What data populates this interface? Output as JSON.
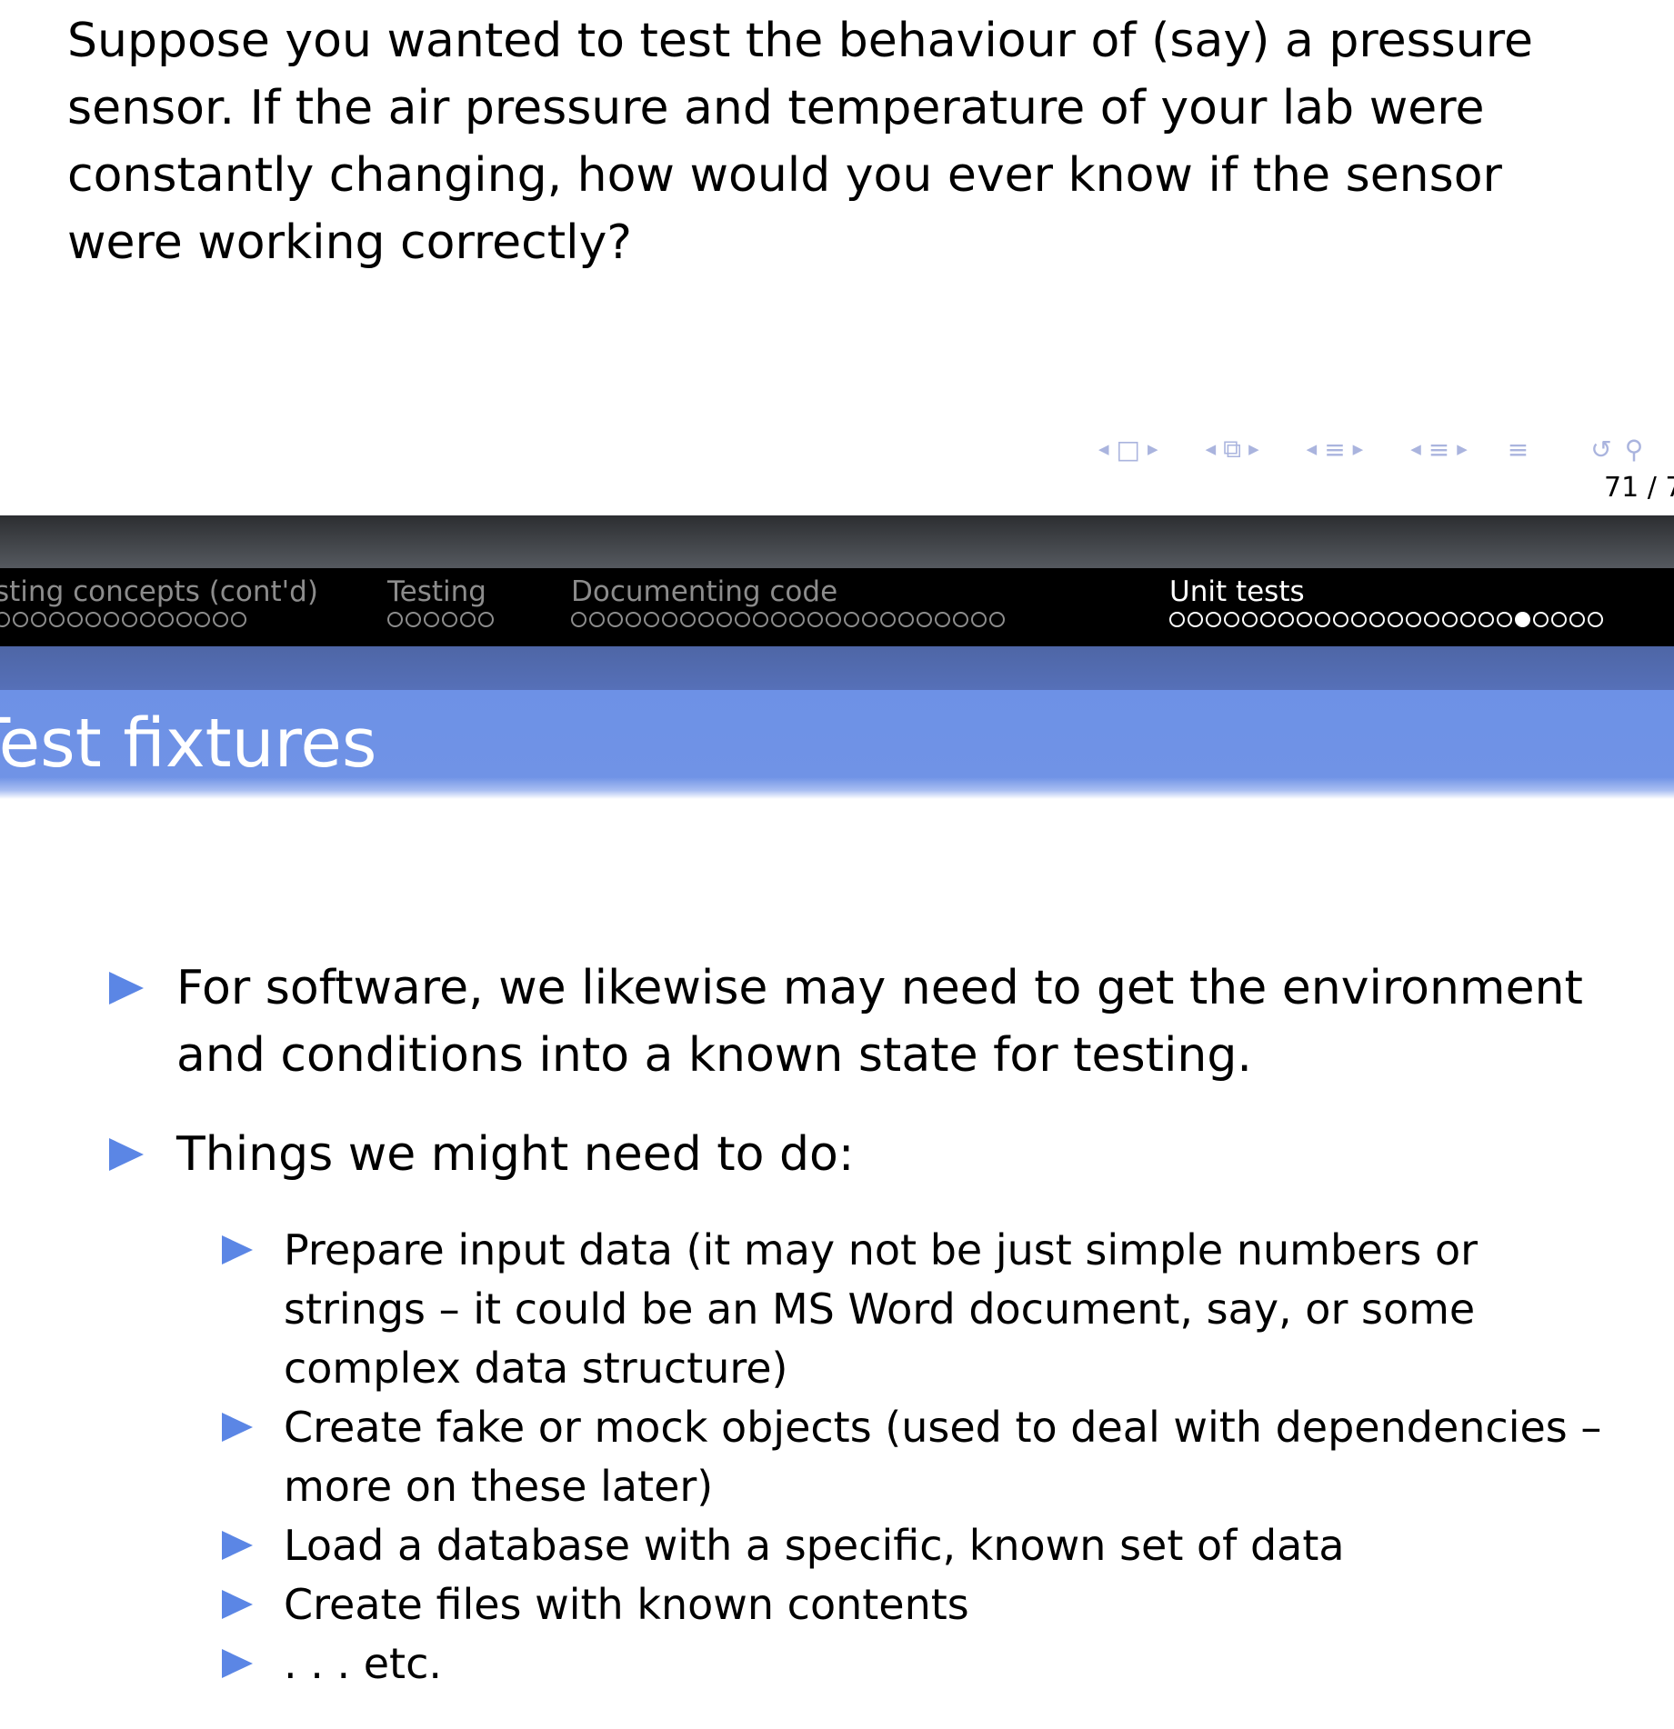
{
  "previous_slide": {
    "paragraph": "Suppose you wanted to test the behaviour of (say) a pressure sensor. If the air pressure and temperature of your lab were constantly changing, how would you ever know if the sensor were working correctly?",
    "page_number": "71 / 7"
  },
  "nav_controls": {
    "frame_icon": "□",
    "subsection_icon": "⧉",
    "section_icon": "≡",
    "document_icon": "≡",
    "toc_icon": "≡",
    "back_icon": "↺",
    "search_icon": "⚲"
  },
  "header": {
    "sections": [
      {
        "title": "sting concepts (cont'd)",
        "dots": 14,
        "filled": -1,
        "active": false
      },
      {
        "title": "Testing",
        "dots": 6,
        "filled": -1,
        "active": false
      },
      {
        "title": "Documenting code",
        "dots": 24,
        "filled": -1,
        "active": false
      },
      {
        "title": "Unit tests",
        "dots": 24,
        "filled": 19,
        "active": true
      }
    ],
    "frame_title": "Test fixtures"
  },
  "content": {
    "bullets": [
      {
        "level": 1,
        "text": "For software, we likewise may need to get the environment and conditions into a known state for testing."
      },
      {
        "level": 1,
        "text": "Things we might need to do:"
      },
      {
        "level": 2,
        "text": "Prepare input data (it may not be just simple numbers or strings – it could be an MS Word document, say, or some complex data structure)"
      },
      {
        "level": 2,
        "text": "Create fake or mock objects (used to deal with dependencies – more on these later)"
      },
      {
        "level": 2,
        "text": "Load a database with a specific, known set of data"
      },
      {
        "level": 2,
        "text": "Create files with known contents"
      },
      {
        "level": 2,
        "text": ". . .  etc."
      }
    ]
  },
  "colors": {
    "bullet_marker": "#5b86e5",
    "title_band": "#7093e6",
    "sub_band": "#5670b8",
    "nav_bar": "#000000",
    "inactive_nav_text": "#8c8c8c",
    "nav_controls": "#aab4de"
  }
}
